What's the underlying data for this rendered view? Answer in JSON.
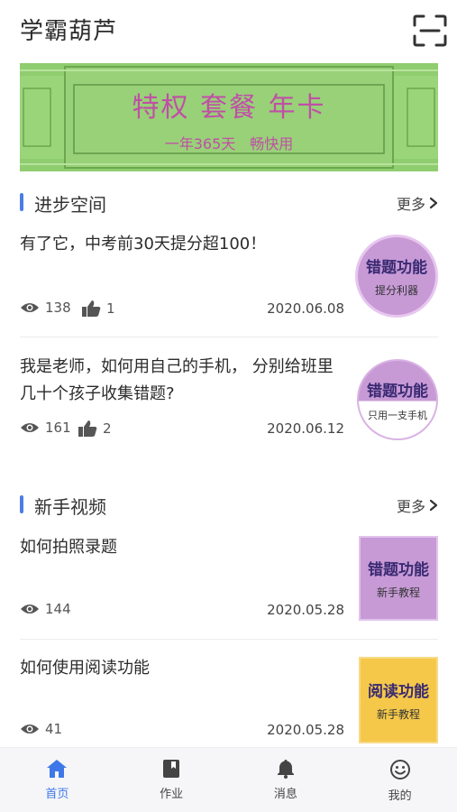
{
  "header": {
    "app_title": "学霸葫芦"
  },
  "banner": {
    "title": "特权 套餐 年卡",
    "subtitle": "一年365天　畅快用"
  },
  "sections": [
    {
      "title": "进步空间",
      "more_label": "更多",
      "items": [
        {
          "title": "有了它，中考前30天提分超100！",
          "views": "138",
          "likes": "1",
          "date": "2020.06.08",
          "thumb_main": "错题功能",
          "thumb_sub": "提分利器"
        },
        {
          "title": "我是老师，如何用自己的手机， 分别给班里几十个孩子收集错题?",
          "views": "161",
          "likes": "2",
          "date": "2020.06.12",
          "thumb_main": "错题功能",
          "thumb_sub": "只用一支手机"
        }
      ]
    },
    {
      "title": "新手视频",
      "more_label": "更多",
      "items": [
        {
          "title": "如何拍照录题",
          "views": "144",
          "date": "2020.05.28",
          "thumb_main": "错题功能",
          "thumb_sub": "新手教程"
        },
        {
          "title": "如何使用阅读功能",
          "views": "41",
          "date": "2020.05.28",
          "thumb_main": "阅读功能",
          "thumb_sub": "新手教程"
        }
      ]
    }
  ],
  "tabbar": [
    {
      "label": "首页",
      "icon": "home-icon",
      "active": true
    },
    {
      "label": "作业",
      "icon": "book-icon",
      "active": false
    },
    {
      "label": "消息",
      "icon": "bell-icon",
      "active": false
    },
    {
      "label": "我的",
      "icon": "smiley-icon",
      "active": false
    }
  ],
  "colors": {
    "accent": "#3e78e8",
    "section_bar": "#4b7de6",
    "banner_green": "#8fcd6f",
    "banner_text": "#c04fa6",
    "thumb_purple": "#c79ad6",
    "thumb_yellow": "#f5c84a"
  }
}
